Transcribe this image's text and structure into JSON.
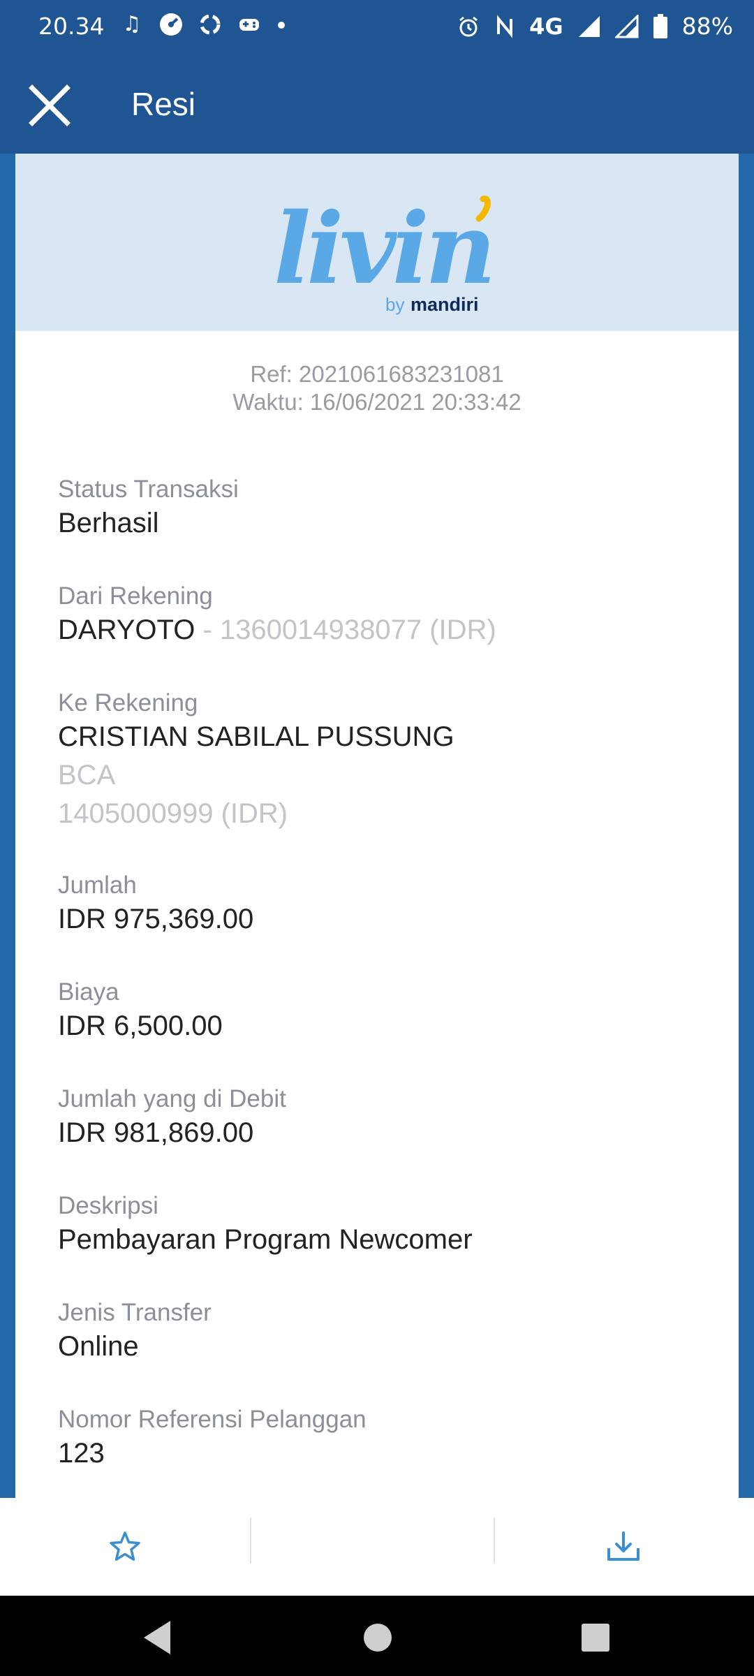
{
  "status_bar": {
    "time": "20.34",
    "network": "4G",
    "battery": "88%",
    "left_icons": [
      "music-icon",
      "speedometer-icon",
      "sync-icon",
      "gamepad-icon",
      "dot-icon"
    ],
    "right_icons": [
      "alarm-icon",
      "nfc-icon",
      "signal-icon",
      "signal-icon",
      "battery-icon"
    ]
  },
  "app_bar": {
    "title": "Resi",
    "close_icon": "close-icon"
  },
  "logo": {
    "brand": "livin",
    "byline": "by",
    "bank": "mandiri",
    "colors": {
      "brand_blue": "#5aa8e6",
      "accent_yellow": "#f5b800",
      "navy": "#0d2c5a"
    }
  },
  "receipt": {
    "ref": "Ref: 2021061683231081",
    "time": "Waktu: 16/06/2021 20:33:42",
    "status": {
      "label": "Status Transaksi",
      "value": "Berhasil"
    },
    "from": {
      "label": "Dari Rekening",
      "name": "DARYOTO",
      "detail": " - 1360014938077 (IDR)"
    },
    "to": {
      "label": "Ke Rekening",
      "name": "CRISTIAN SABILAL PUSSUNG",
      "bank": "BCA",
      "account": "1405000999 (IDR)"
    },
    "amount": {
      "label": "Jumlah",
      "value": "IDR 975,369.00"
    },
    "fee": {
      "label": "Biaya",
      "value": "IDR 6,500.00"
    },
    "debited": {
      "label": "Jumlah yang di Debit",
      "value": "IDR 981,869.00"
    },
    "description": {
      "label": "Deskripsi",
      "value": "Pembayaran Program Newcomer"
    },
    "transfer_type": {
      "label": "Jenis Transfer",
      "value": "Online"
    },
    "customer_ref": {
      "label": "Nomor Referensi Pelanggan",
      "value": "123"
    }
  },
  "actions": {
    "favorite_icon": "star-icon",
    "download_icon": "download-icon"
  },
  "colors": {
    "header": "#1f5592",
    "frame": "#2368a8",
    "accent": "#3a8fd0"
  }
}
